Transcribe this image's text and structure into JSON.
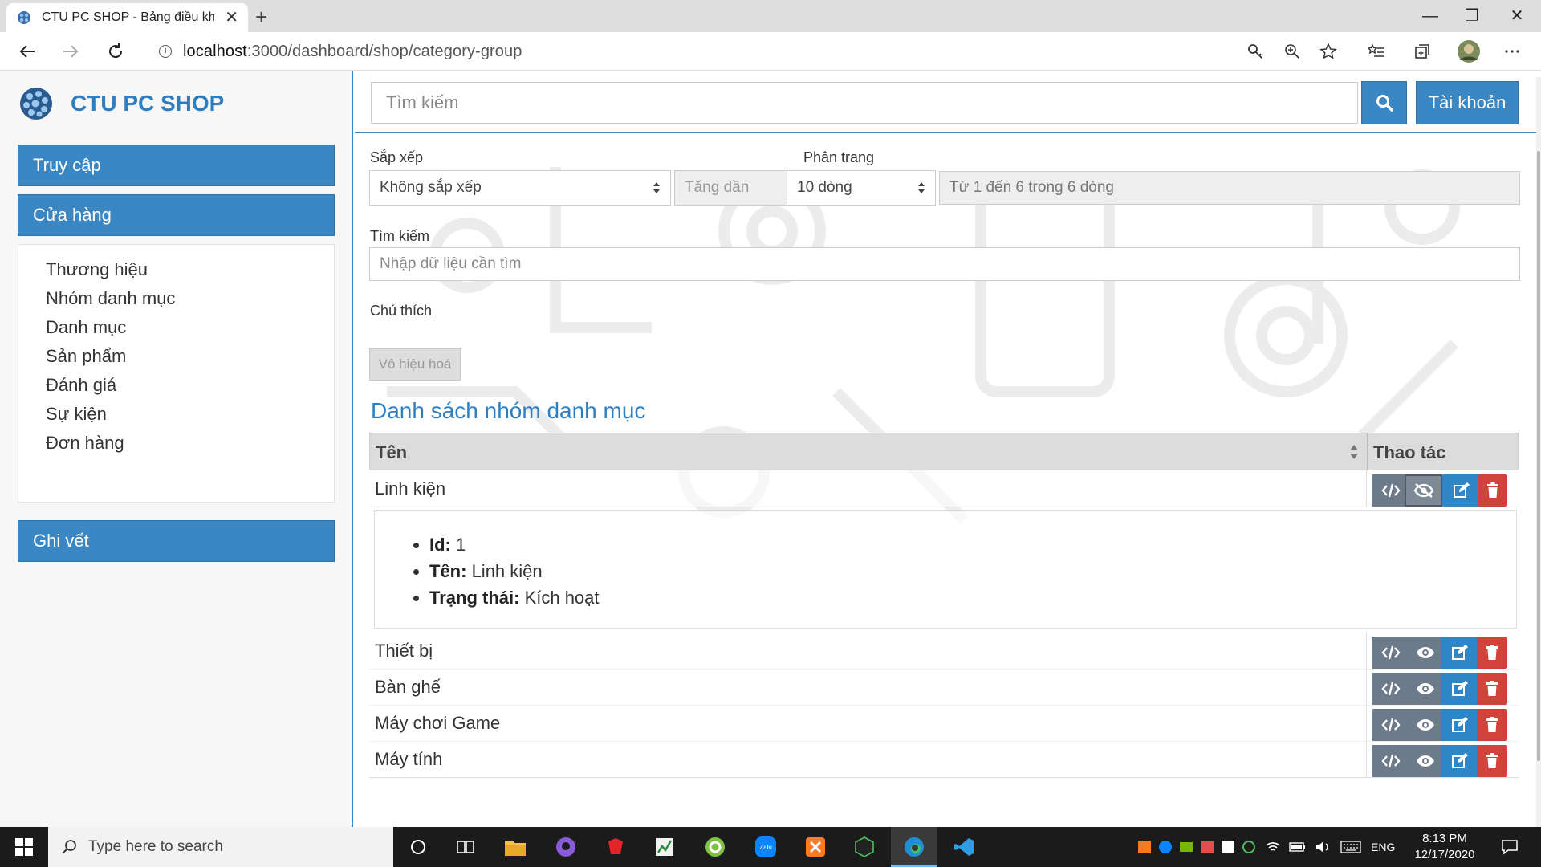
{
  "browser": {
    "tab_title": "CTU PC SHOP - Bảng điều khiển",
    "url_host": "localhost",
    "url_path": ":3000/dashboard/shop/category-group"
  },
  "brand": {
    "name": "CTU PC SHOP"
  },
  "sidebar": {
    "access_label": "Truy cập",
    "shop_label": "Cửa hàng",
    "log_label": "Ghi vết",
    "items": [
      {
        "label": "Thương hiệu"
      },
      {
        "label": "Nhóm danh mục"
      },
      {
        "label": "Danh mục"
      },
      {
        "label": "Sản phẩm"
      },
      {
        "label": "Đánh giá"
      },
      {
        "label": "Sự kiện"
      },
      {
        "label": "Đơn hàng"
      }
    ]
  },
  "header": {
    "search_placeholder": "Tìm kiếm",
    "account_label": "Tài khoản"
  },
  "controls": {
    "sort_label": "Sắp xếp",
    "sort_value": "Không sắp xếp",
    "order_value": "Tăng dần",
    "paging_label": "Phân trang",
    "paging_value": "10 dòng",
    "paging_info": "Từ 1 đến 6 trong 6 dòng",
    "search_label": "Tìm kiếm",
    "search_placeholder": "Nhập dữ liệu cần tìm",
    "legend_label": "Chú thích",
    "legend_button": "Vô hiệu hoá"
  },
  "list": {
    "title": "Danh sách nhóm danh mục",
    "col_name": "Tên",
    "col_actions": "Thao tác",
    "rows": [
      {
        "name": "Linh kiện"
      },
      {
        "name": "Thiết bị"
      },
      {
        "name": "Bàn ghế"
      },
      {
        "name": "Máy chơi Game"
      },
      {
        "name": "Máy tính"
      }
    ],
    "detail": {
      "id_label": "Id:",
      "id_value": " 1",
      "name_label": "Tên:",
      "name_value": " Linh kiện",
      "status_label": "Trạng thái:",
      "status_value": " Kích hoạt"
    }
  },
  "taskbar": {
    "search_placeholder": "Type here to search",
    "lang": "ENG",
    "time": "8:13 PM",
    "date": "12/17/2020"
  },
  "colors": {
    "primary": "#3b87c3",
    "danger": "#d0433b",
    "secondary": "#6d7a8a"
  }
}
